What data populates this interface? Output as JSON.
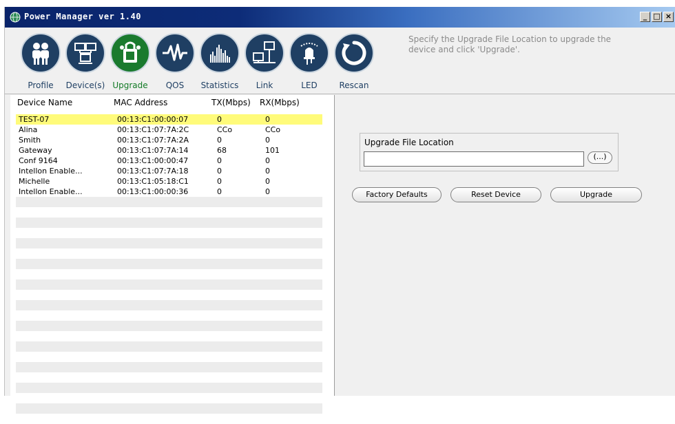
{
  "window": {
    "title": "Power Manager ver 1.40",
    "minimize": "_",
    "maximize": "□",
    "close": "×"
  },
  "toolbar": {
    "items": [
      {
        "label": "Profile",
        "icon": "people-icon"
      },
      {
        "label": "Device(s)",
        "icon": "devices-icon"
      },
      {
        "label": "Upgrade",
        "icon": "upgrade-icon"
      },
      {
        "label": "QOS",
        "icon": "waveform-icon"
      },
      {
        "label": "Statistics",
        "icon": "bar-graph-icon"
      },
      {
        "label": "Link",
        "icon": "network-link-icon"
      },
      {
        "label": "LED",
        "icon": "led-icon"
      },
      {
        "label": "Rescan",
        "icon": "refresh-icon"
      }
    ],
    "active": "Upgrade",
    "hint": "Specify the Upgrade File Location to upgrade the device and click 'Upgrade'."
  },
  "device_table": {
    "columns": [
      "Device Name",
      "MAC Address",
      "TX(Mbps)",
      "RX(Mbps)"
    ],
    "rows": [
      [
        "TEST-07",
        "00:13:C1:00:00:07",
        "0",
        "0"
      ],
      [
        "Alina",
        "00:13:C1:07:7A:2C",
        "CCo",
        "CCo"
      ],
      [
        "Smith",
        "00:13:C1:07:7A:2A",
        "0",
        "0"
      ],
      [
        "Gateway",
        "00:13:C1:07:7A:14",
        "68",
        "101"
      ],
      [
        "Conf 9164",
        "00:13:C1:00:00:47",
        "0",
        "0"
      ],
      [
        "Intellon Enable...",
        "00:13:C1:07:7A:18",
        "0",
        "0"
      ],
      [
        "Michelle",
        "00:13:C1:05:18:C1",
        "0",
        "0"
      ],
      [
        "Intellon Enable...",
        "00:13:C1:00:00:36",
        "0",
        "0"
      ]
    ],
    "selected_index": 0
  },
  "upgrade_panel": {
    "group_label": "Upgrade File Location",
    "file_value": "",
    "browse_label": "(...)",
    "buttons": {
      "factory_defaults": "Factory Defaults",
      "reset_device": "Reset Device",
      "upgrade": "Upgrade"
    }
  },
  "colors": {
    "title_gradient_start": "#0a246a",
    "title_gradient_end": "#a6caf0",
    "icon_circle": "#1f3f63",
    "icon_active": "#1a7a2e",
    "selected_row": "#fffb7a"
  }
}
